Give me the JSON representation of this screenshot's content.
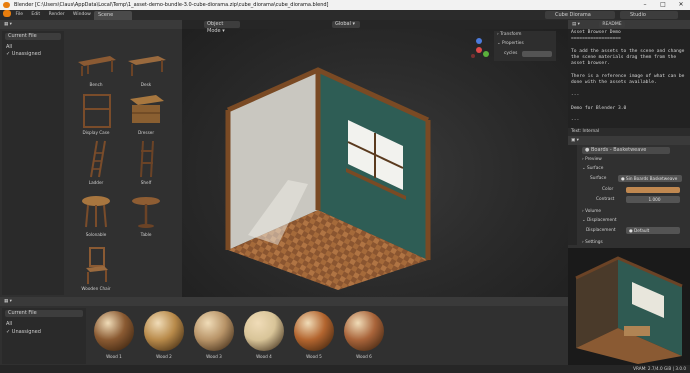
{
  "window": {
    "title": "Blender [C:\\Users\\Claus\\AppData\\Local\\Temp\\1_asset-demo-bundle-3.0-cube-diorama.zip\\cube_diorama\\cube_diorama.blend]"
  },
  "menu": [
    "File",
    "Edit",
    "Render",
    "Window",
    "Help"
  ],
  "workspace_tab": "Scene",
  "scene_field": "Cube Diorama",
  "layer_field": "Studio",
  "viewport": {
    "mode": "Object Mode",
    "orientation": "Global"
  },
  "n_panel": {
    "transform": "Transform",
    "properties": "Properties",
    "prop_name": "cycles"
  },
  "asset_browser_top": {
    "library": "Current File",
    "catalogs": [
      "All",
      "Unassigned"
    ],
    "assets": [
      "Bench",
      "Desk",
      "Display Case",
      "Dresser",
      "Ladder",
      "Shelf",
      "Solonable",
      "Table",
      "Wooden Chair"
    ]
  },
  "asset_browser_bottom": {
    "library": "Current File",
    "catalogs": [
      "All",
      "Unassigned"
    ],
    "materials": [
      "Wood 1",
      "Wood 2",
      "Wood 3",
      "Wood 4",
      "Wood 5",
      "Wood 6"
    ],
    "material_colors": [
      "#8a5a32",
      "#b88a4a",
      "#b89468",
      "#d8c498",
      "#b3652f",
      "#a9643a"
    ]
  },
  "text_editor": {
    "file": "README",
    "lines": [
      "Asset Browser Demo",
      "==================",
      "",
      "To add the assets to the scene and change",
      "the scene materials drag them from the",
      "asset browser.",
      "",
      "There is a reference image of what can be",
      "done with the assets available.",
      "",
      "---",
      "",
      "Demo for Blender 3.0",
      "",
      "---",
      "",
      "License: CC-0"
    ],
    "footer": "Text: Internal"
  },
  "properties": {
    "material": "Boards - Basketweave",
    "sections": {
      "preview": "Preview",
      "surface": "Surface",
      "volume": "Volume",
      "displacement": "Displacement",
      "settings": "Settings"
    },
    "surface_label": "Surface",
    "surface_value": "Sin Boards Basketweave",
    "color_label": "Color",
    "color_value": "#c08850",
    "contrast_label": "Contrast",
    "contrast_value": "1.000",
    "displacement_label": "Displacement",
    "displacement_value": "Default"
  },
  "statusbar": {
    "stats": "VRAM: 2.7/4.0 GiB | 3.0.0"
  }
}
